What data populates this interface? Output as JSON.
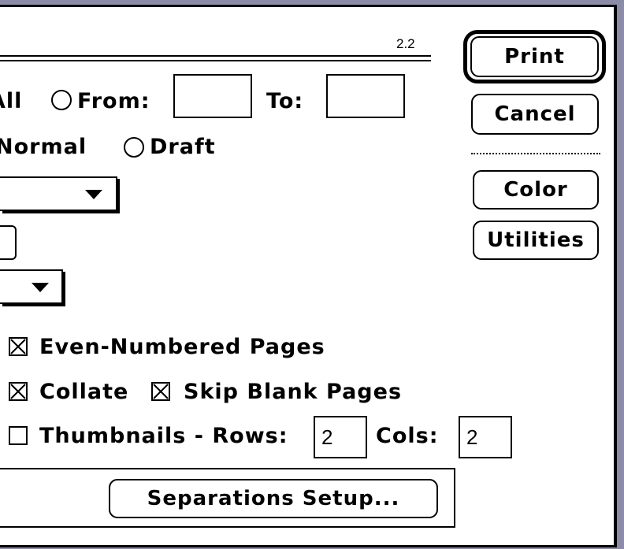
{
  "dialog": {
    "version": "2.2",
    "pages": {
      "all_label": "All",
      "from_label": "From:",
      "from_value": "",
      "to_label": "To:",
      "to_value": ""
    },
    "quality": {
      "normal_label": "Normal",
      "draft_label": "Draft"
    },
    "options": {
      "even_pages_label": "Even-Numbered Pages",
      "collate_label": "Collate",
      "skip_blank_label": "Skip Blank Pages",
      "thumbnails_label": "Thumbnails - Rows:",
      "rows_value": "2",
      "cols_label": "Cols:",
      "cols_value": "2"
    },
    "buttons": {
      "print": "Print",
      "cancel": "Cancel",
      "color": "Color",
      "utilities": "Utilities",
      "separations": "Separations Setup..."
    }
  }
}
